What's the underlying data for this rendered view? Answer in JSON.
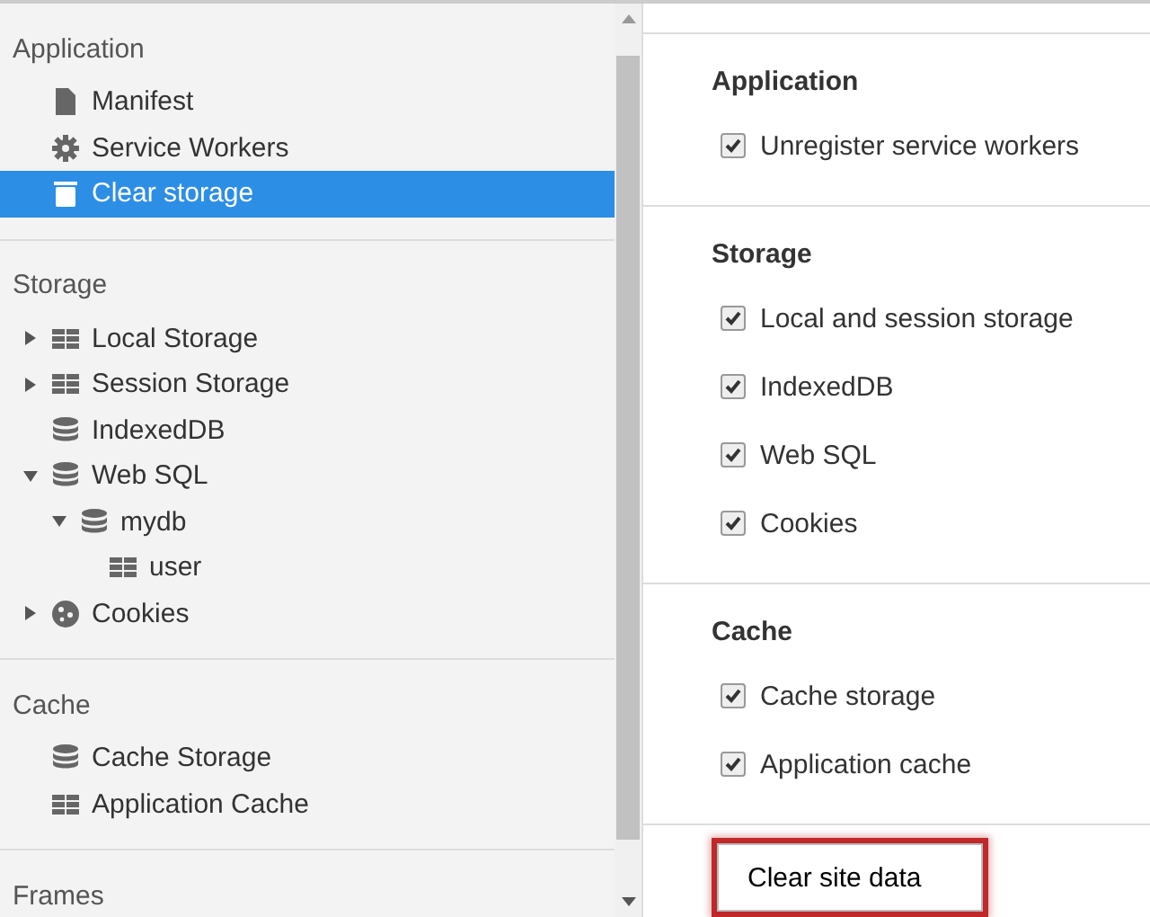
{
  "sidebar": {
    "sections": [
      {
        "title": "Application",
        "items": [
          {
            "label": "Manifest",
            "kind": "file",
            "selected": false
          },
          {
            "label": "Service Workers",
            "kind": "gear",
            "selected": false
          },
          {
            "label": "Clear storage",
            "kind": "trash",
            "selected": true
          }
        ]
      },
      {
        "title": "Storage",
        "items": [
          {
            "label": "Local Storage",
            "kind": "table",
            "selected": false,
            "expanded": false
          },
          {
            "label": "Session Storage",
            "kind": "table",
            "selected": false,
            "expanded": false
          },
          {
            "label": "IndexedDB",
            "kind": "database",
            "selected": false
          },
          {
            "label": "Web SQL",
            "kind": "database",
            "selected": false,
            "expanded": true,
            "children": [
              {
                "label": "mydb",
                "kind": "database",
                "selected": false,
                "expanded": true,
                "children": [
                  {
                    "label": "user",
                    "kind": "table",
                    "selected": false
                  }
                ]
              }
            ]
          },
          {
            "label": "Cookies",
            "kind": "cookie",
            "selected": false,
            "expanded": false
          }
        ]
      },
      {
        "title": "Cache",
        "items": [
          {
            "label": "Cache Storage",
            "kind": "database",
            "selected": false
          },
          {
            "label": "Application Cache",
            "kind": "table",
            "selected": false
          }
        ]
      },
      {
        "title": "Frames"
      }
    ]
  },
  "panel": {
    "sections": [
      {
        "title": "Application",
        "options": [
          {
            "label": "Unregister service workers",
            "checked": true
          }
        ]
      },
      {
        "title": "Storage",
        "options": [
          {
            "label": "Local and session storage",
            "checked": true
          },
          {
            "label": "IndexedDB",
            "checked": true
          },
          {
            "label": "Web SQL",
            "checked": true
          },
          {
            "label": "Cookies",
            "checked": true
          }
        ]
      },
      {
        "title": "Cache",
        "options": [
          {
            "label": "Cache storage",
            "checked": true
          },
          {
            "label": "Application cache",
            "checked": true
          }
        ]
      }
    ],
    "button": {
      "label": "Clear site data",
      "highlighted": true
    }
  }
}
